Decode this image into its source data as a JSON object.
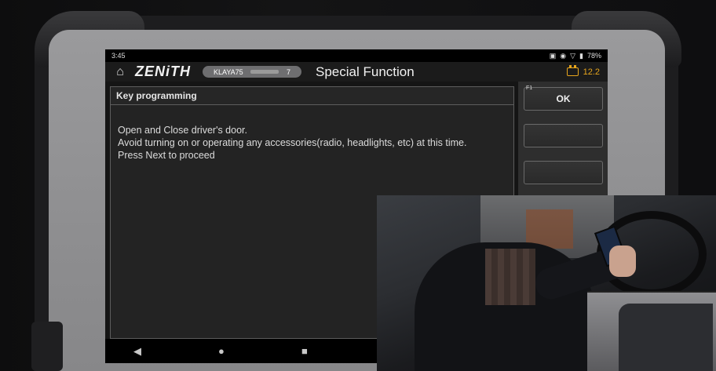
{
  "status_bar": {
    "time": "3:45",
    "battery_percent": "78%"
  },
  "app_bar": {
    "brand": "ZENiTH",
    "vin_prefix": "KLAYA75",
    "vin_suffix": "7",
    "title": "Special Function",
    "voltage": "12.2"
  },
  "panel": {
    "header": "Key programming",
    "lines": [
      "Open and Close driver's door.",
      "Avoid turning on or operating any accessories(radio, headlights, etc) at this time.",
      "Press Next to proceed"
    ]
  },
  "side_buttons": [
    {
      "fkey": "F1",
      "label": "OK"
    },
    {
      "fkey": "",
      "label": ""
    },
    {
      "fkey": "",
      "label": ""
    }
  ],
  "nav": {
    "back_glyph": "◀",
    "home_glyph": "●",
    "recents_glyph": "■"
  },
  "icons": {
    "home": "home-icon",
    "battery": "car-battery-icon"
  },
  "colors": {
    "accent": "#e7a51c",
    "screen_bg": "#151515",
    "bezel": "#8e8e90"
  }
}
